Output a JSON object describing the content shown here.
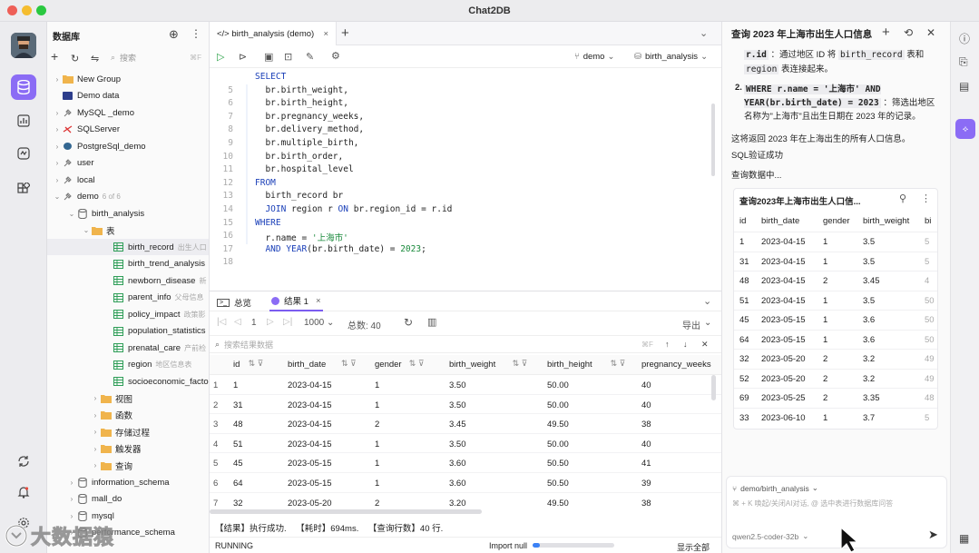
{
  "app": {
    "title": "Chat2DB"
  },
  "sidebar": {
    "title": "数据库",
    "search_placeholder": "搜索",
    "search_shortcut": "⌘F",
    "items": [
      {
        "label": "New Group",
        "sub": "",
        "icon": "folder"
      },
      {
        "label": "Demo data",
        "sub": "",
        "icon": "db"
      },
      {
        "label": "MySQL _demo",
        "sub": "",
        "icon": "plug"
      },
      {
        "label": "SQLServer",
        "sub": "",
        "icon": "plug"
      },
      {
        "label": "PostgreSql_demo",
        "sub": "",
        "icon": "plug"
      },
      {
        "label": "user",
        "sub": "",
        "icon": "plug"
      },
      {
        "label": "local",
        "sub": "",
        "icon": "plug"
      },
      {
        "label": "demo",
        "sub": "6 of 6",
        "icon": "plug"
      },
      {
        "label": "birth_analysis",
        "sub": "",
        "icon": "db"
      },
      {
        "label": "表",
        "sub": "",
        "icon": "folder"
      },
      {
        "label": "birth_record",
        "sub": "出生人口",
        "icon": "table"
      },
      {
        "label": "birth_trend_analysis",
        "sub": "",
        "icon": "table"
      },
      {
        "label": "newborn_disease",
        "sub": "新",
        "icon": "table"
      },
      {
        "label": "parent_info",
        "sub": "父母信息",
        "icon": "table"
      },
      {
        "label": "policy_impact",
        "sub": "政策影",
        "icon": "table"
      },
      {
        "label": "population_statistics",
        "sub": "",
        "icon": "table"
      },
      {
        "label": "prenatal_care",
        "sub": "产前检",
        "icon": "table"
      },
      {
        "label": "region",
        "sub": "地区信息表",
        "icon": "table"
      },
      {
        "label": "socioeconomic_facto",
        "sub": "",
        "icon": "table"
      },
      {
        "label": "视图",
        "sub": "",
        "icon": "folder"
      },
      {
        "label": "函数",
        "sub": "",
        "icon": "folder"
      },
      {
        "label": "存储过程",
        "sub": "",
        "icon": "folder"
      },
      {
        "label": "触发器",
        "sub": "",
        "icon": "folder"
      },
      {
        "label": "查询",
        "sub": "",
        "icon": "folder"
      },
      {
        "label": "information_schema",
        "sub": "",
        "icon": "db"
      },
      {
        "label": "mall_do",
        "sub": "",
        "icon": "db"
      },
      {
        "label": "mysql",
        "sub": "",
        "icon": "db"
      },
      {
        "label": "performance_schema",
        "sub": "",
        "icon": "db"
      }
    ]
  },
  "editor": {
    "tab_label": "</> birth_analysis (demo)",
    "datasource": "demo",
    "database": "birth_analysis",
    "lines": [
      {
        "n": "",
        "t": "SELECT",
        "c": "kw"
      },
      {
        "n": "5",
        "t": "  br.birth_weight,",
        "c": ""
      },
      {
        "n": "6",
        "t": "  br.birth_height,",
        "c": ""
      },
      {
        "n": "7",
        "t": "  br.pregnancy_weeks,",
        "c": ""
      },
      {
        "n": "8",
        "t": "  br.delivery_method,",
        "c": ""
      },
      {
        "n": "9",
        "t": "  br.multiple_birth,",
        "c": ""
      },
      {
        "n": "10",
        "t": "  br.birth_order,",
        "c": ""
      },
      {
        "n": "11",
        "t": "  br.hospital_level",
        "c": ""
      },
      {
        "n": "12",
        "t": "FROM",
        "c": "kw"
      },
      {
        "n": "13",
        "t": "  birth_record br",
        "c": ""
      },
      {
        "n": "14",
        "t": "  JOIN region r ON br.region_id = r.id",
        "c": ""
      },
      {
        "n": "15",
        "t": "WHERE",
        "c": "kw"
      },
      {
        "n": "16",
        "t": "  r.name = '上海市'",
        "c": ""
      },
      {
        "n": "17",
        "t": "  AND YEAR(br.birth_date) = 2023;",
        "c": ""
      },
      {
        "n": "18",
        "t": "",
        "c": ""
      }
    ]
  },
  "results": {
    "tab_overview": "总览",
    "tab_result": "结果 1",
    "page": "1",
    "page_size": "1000",
    "total_label": "总数: 40",
    "search_placeholder": "搜索结果数据",
    "export_label": "导出",
    "columns": [
      "id",
      "birth_date",
      "gender",
      "birth_weight",
      "birth_height",
      "pregnancy_weeks"
    ],
    "rows": [
      [
        "1",
        "2023-04-15",
        "1",
        "3.50",
        "50.00",
        "40"
      ],
      [
        "31",
        "2023-04-15",
        "1",
        "3.50",
        "50.00",
        "40"
      ],
      [
        "48",
        "2023-04-15",
        "2",
        "3.45",
        "49.50",
        "38"
      ],
      [
        "51",
        "2023-04-15",
        "1",
        "3.50",
        "50.00",
        "40"
      ],
      [
        "45",
        "2023-05-15",
        "1",
        "3.60",
        "50.50",
        "41"
      ],
      [
        "64",
        "2023-05-15",
        "1",
        "3.60",
        "50.50",
        "39"
      ],
      [
        "32",
        "2023-05-20",
        "2",
        "3.20",
        "49.50",
        "38"
      ]
    ],
    "row_nums": [
      "1",
      "2",
      "3",
      "4",
      "5",
      "6",
      "7"
    ],
    "status_message": "【结果】执行成功.    【耗时】694ms.    【查询行数】40 行.",
    "running": "RUNNING",
    "import_label": "Import null",
    "show_all": "显示全部"
  },
  "ai": {
    "title": "查询 2023 年上海市出生人口信息",
    "para1_code1": "r.id",
    "para1_text": "：通过地区 ID 将",
    "para1_code2": "birth_record",
    "para1_text2": "表和",
    "para1_code3": "region",
    "para1_text3": "表连接起来。",
    "item2_num": "2.",
    "item2_code": "WHERE r.name = '上海市' AND YEAR(br.birth_date) = 2023",
    "item2_text": "：筛选出地区名称为\"上海市\"且出生日期在 2023 年的记录。",
    "summary": "这将返回 2023 年在上海出生的所有人口信息。",
    "verify": "SQL验证成功",
    "querying": "查询数据中...",
    "card_title": "查询2023年上海市出生人口信...",
    "card_columns": [
      "id",
      "birth_date",
      "gender",
      "birth_weight",
      "bi"
    ],
    "card_rows": [
      [
        "1",
        "2023-04-15",
        "1",
        "3.5",
        "5"
      ],
      [
        "31",
        "2023-04-15",
        "1",
        "3.5",
        "5"
      ],
      [
        "48",
        "2023-04-15",
        "2",
        "3.45",
        "4"
      ],
      [
        "51",
        "2023-04-15",
        "1",
        "3.5",
        "50"
      ],
      [
        "45",
        "2023-05-15",
        "1",
        "3.6",
        "50"
      ],
      [
        "64",
        "2023-05-15",
        "1",
        "3.6",
        "50"
      ],
      [
        "32",
        "2023-05-20",
        "2",
        "3.2",
        "49"
      ],
      [
        "52",
        "2023-05-20",
        "2",
        "3.2",
        "49"
      ],
      [
        "69",
        "2023-05-25",
        "2",
        "3.35",
        "48"
      ],
      [
        "33",
        "2023-06-10",
        "1",
        "3.7",
        "5"
      ]
    ],
    "context": "demo/birth_analysis",
    "input_placeholder": "⌘ + K 唤起/关闭AI对话, @ 选中表进行数据库问答",
    "model": "qwen2.5-coder-32b"
  },
  "watermark": "大数据猿",
  "colors": {
    "accent": "#7b5cf0",
    "success": "#2aa146",
    "keyword": "#1a3fb8",
    "string": "#1a8a3c",
    "folder": "#e8a33a",
    "table": "#2f9e58"
  }
}
